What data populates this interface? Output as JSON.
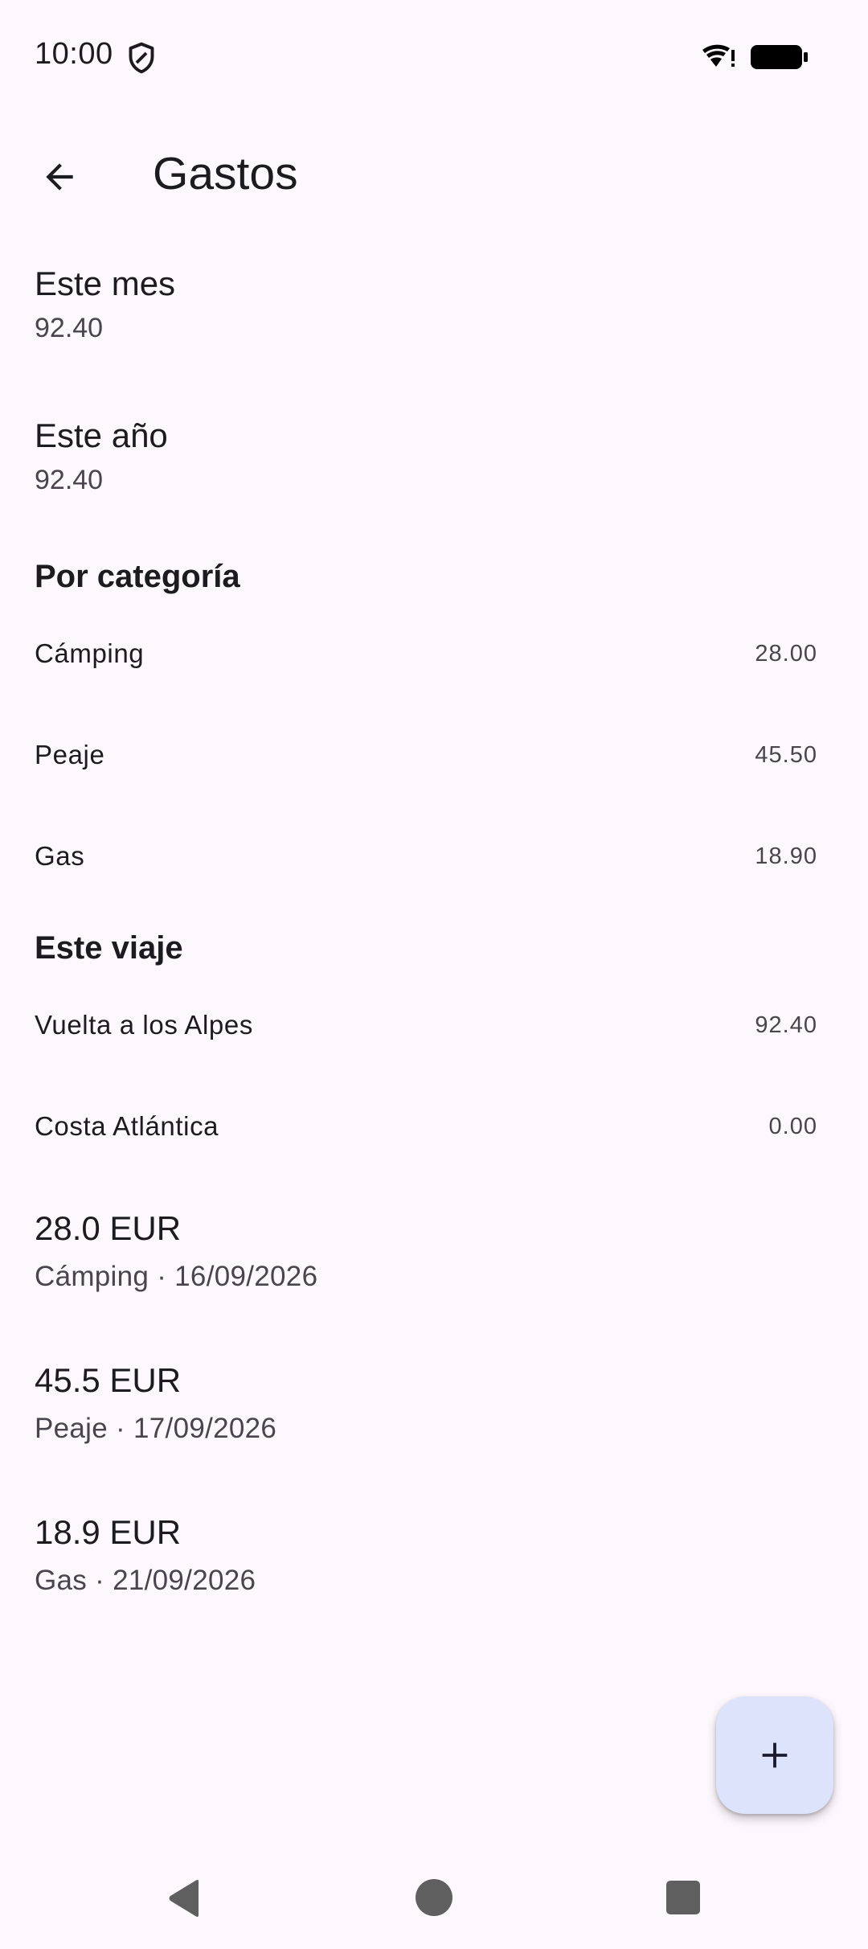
{
  "status_bar": {
    "time": "10:00",
    "icons": [
      "shield-icon",
      "wifi-icon",
      "battery-icon"
    ]
  },
  "app_bar": {
    "title": "Gastos",
    "back_icon": "arrow-back-icon"
  },
  "summary": {
    "month_label": "Este mes",
    "month_value": "92.40",
    "year_label": "Este año",
    "year_value": "92.40"
  },
  "by_category": {
    "header": "Por categoría",
    "items": [
      {
        "label": "Cámping",
        "value": "28.00"
      },
      {
        "label": "Peaje",
        "value": "45.50"
      },
      {
        "label": "Gas",
        "value": "18.90"
      }
    ]
  },
  "this_trip": {
    "header": "Este viaje",
    "items": [
      {
        "label": "Vuelta a los Alpes",
        "value": "92.40"
      },
      {
        "label": "Costa Atlántica",
        "value": "0.00"
      }
    ]
  },
  "expenses": [
    {
      "amount": "28.0 EUR",
      "meta": "Cámping · 16/09/2026"
    },
    {
      "amount": "45.5 EUR",
      "meta": "Peaje · 17/09/2026"
    },
    {
      "amount": "18.9 EUR",
      "meta": "Gas · 21/09/2026"
    }
  ],
  "fab": {
    "icon": "add-icon"
  },
  "colors": {
    "background": "#FDF8FD",
    "text_primary": "#1C1B1F",
    "text_secondary": "#49454F",
    "fab_container": "#DDE3FA"
  }
}
